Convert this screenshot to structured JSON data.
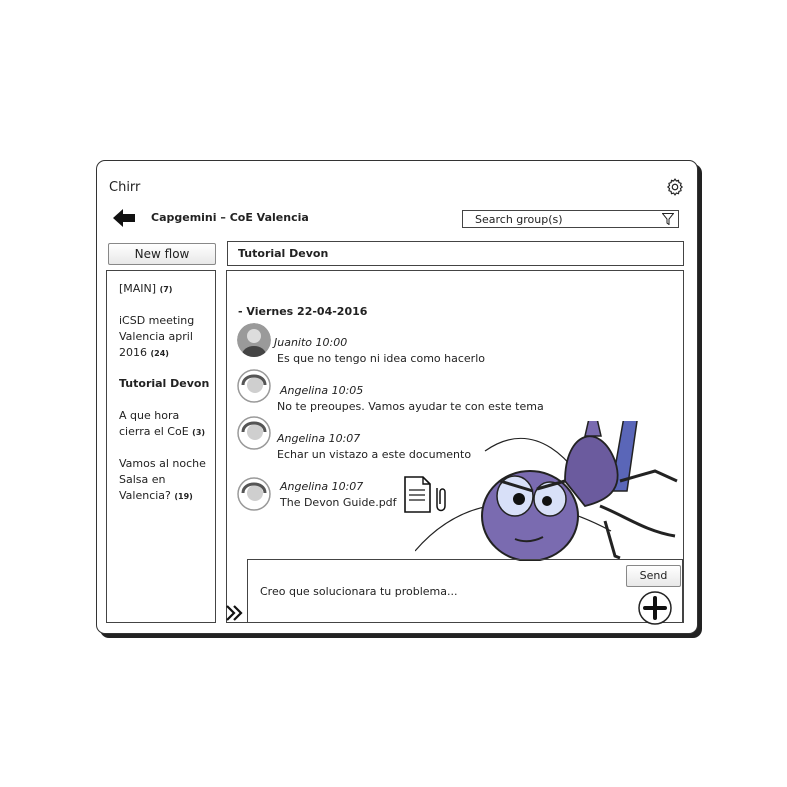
{
  "app": {
    "title": "Chirr"
  },
  "header": {
    "group_title": "Capgemini – CoE Valencia",
    "search_placeholder": "Search group(s)"
  },
  "sidebar": {
    "new_flow_label": "New flow",
    "items": [
      {
        "label": "[MAIN]",
        "count": "(7)",
        "active": false
      },
      {
        "label": "iCSD meeting Valencia april 2016",
        "count": "(24)",
        "active": false
      },
      {
        "label": "Tutorial Devon",
        "count": "",
        "active": true
      },
      {
        "label": "A que hora cierra el CoE",
        "count": "(3)",
        "active": false
      },
      {
        "label": "Vamos al noche Salsa en Valencia?",
        "count": "(19)",
        "active": false
      }
    ]
  },
  "topic": {
    "title": "Tutorial Devon"
  },
  "chat": {
    "date_header": "- Viernes 22-04-2016",
    "messages": [
      {
        "meta": "Juanito 10:00",
        "text": "Es que no tengo ni idea como hacerlo"
      },
      {
        "meta": "Angelina 10:05",
        "text": "No te preoupes. Vamos ayudar te con este tema"
      },
      {
        "meta": "Angelina 10:07",
        "text": "Echar un vistazo a este documento"
      },
      {
        "meta": "Angelina 10:07",
        "text": "The Devon Guide.pdf"
      }
    ]
  },
  "composer": {
    "text": "Creo que solucionara tu problema...",
    "send_label": "Send"
  },
  "colors": {
    "mascot_purple": "#6b5b9e",
    "mascot_blue": "#5a66b8",
    "border": "#444444"
  },
  "icons": [
    "gear-icon",
    "back-arrow-icon",
    "filter-icon",
    "document-attachment-icon",
    "plus-icon",
    "expand-chevrons-icon"
  ]
}
